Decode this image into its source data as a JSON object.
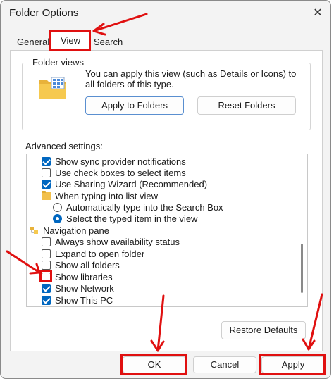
{
  "window": {
    "title": "Folder Options",
    "close_glyph": "✕"
  },
  "tabs": [
    {
      "label": "General"
    },
    {
      "label": "View"
    },
    {
      "label": "Search"
    }
  ],
  "folder_views": {
    "label": "Folder views",
    "description": "You can apply this view (such as Details or Icons) to all folders of this type.",
    "apply_button": "Apply to Folders",
    "reset_button": "Reset Folders"
  },
  "advanced": {
    "label": "Advanced settings:",
    "items": [
      {
        "kind": "checkbox",
        "checked": true,
        "label": "Show sync provider notifications"
      },
      {
        "kind": "checkbox",
        "checked": false,
        "label": "Use check boxes to select items"
      },
      {
        "kind": "checkbox",
        "checked": true,
        "label": "Use Sharing Wizard (Recommended)"
      },
      {
        "kind": "folder",
        "label": "When typing into list view"
      },
      {
        "kind": "radio",
        "checked": false,
        "label": "Automatically type into the Search Box"
      },
      {
        "kind": "radio",
        "checked": true,
        "label": "Select the typed item in the view"
      },
      {
        "kind": "nav",
        "label": "Navigation pane"
      },
      {
        "kind": "checkbox",
        "checked": false,
        "label": "Always show availability status"
      },
      {
        "kind": "checkbox",
        "checked": false,
        "label": "Expand to open folder"
      },
      {
        "kind": "checkbox",
        "checked": false,
        "label": "Show all folders"
      },
      {
        "kind": "checkbox",
        "checked": false,
        "label": "Show libraries"
      },
      {
        "kind": "checkbox",
        "checked": true,
        "label": "Show Network"
      },
      {
        "kind": "checkbox",
        "checked": true,
        "label": "Show This PC"
      }
    ]
  },
  "buttons": {
    "restore_defaults": "Restore Defaults",
    "ok": "OK",
    "cancel": "Cancel",
    "apply": "Apply"
  },
  "colors": {
    "accent": "#0067c0",
    "annotation": "#e01010",
    "folder": "#f2c04c"
  }
}
